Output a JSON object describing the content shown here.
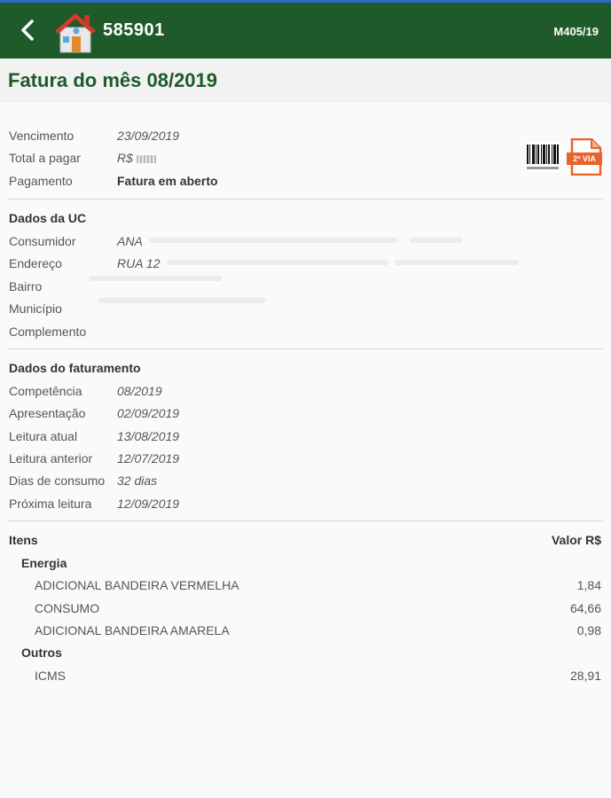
{
  "header": {
    "uc_number": "585901",
    "code": "M405/19",
    "back_icon": "chevron-left-icon",
    "home_icon": "house-icon"
  },
  "page": {
    "title": "Fatura do mês 08/2019"
  },
  "summary": {
    "vencimento_label": "Vencimento",
    "vencimento_value": "23/09/2019",
    "total_label": "Total a pagar",
    "total_value": "R$",
    "pagamento_label": "Pagamento",
    "pagamento_value": "Fatura em aberto",
    "barcode_icon": "barcode-icon",
    "pdf_label": "2ª VIA"
  },
  "uc_section": {
    "title": "Dados da UC",
    "consumidor_label": "Consumidor",
    "consumidor_value": "ANA",
    "endereco_label": "Endereço",
    "endereco_value": "RUA  12",
    "bairro_label": "Bairro",
    "municipio_label": "Município",
    "complemento_label": "Complemento"
  },
  "billing": {
    "title": "Dados do faturamento",
    "rows": [
      {
        "label": "Competência",
        "value": "08/2019"
      },
      {
        "label": "Apresentação",
        "value": "02/09/2019"
      },
      {
        "label": "Leitura atual",
        "value": "13/08/2019"
      },
      {
        "label": "Leitura anterior",
        "value": "12/07/2019"
      },
      {
        "label": "Dias de consumo",
        "value": "32 dias"
      },
      {
        "label": "Próxima leitura",
        "value": "12/09/2019"
      }
    ]
  },
  "items": {
    "header_label": "Itens",
    "header_value": "Valor R$",
    "energia_label": "Energia",
    "energia": [
      {
        "name": "ADICIONAL BANDEIRA VERMELHA",
        "value": "1,84"
      },
      {
        "name": "CONSUMO",
        "value": "64,66"
      },
      {
        "name": "ADICIONAL BANDEIRA AMARELA",
        "value": "0,98"
      }
    ],
    "outros_label": "Outros",
    "outros": [
      {
        "name": "ICMS",
        "value": "28,91"
      }
    ]
  },
  "colors": {
    "header_bg": "#1e5a2a",
    "title": "#1e5a2a",
    "pdf": "#e8622a"
  }
}
